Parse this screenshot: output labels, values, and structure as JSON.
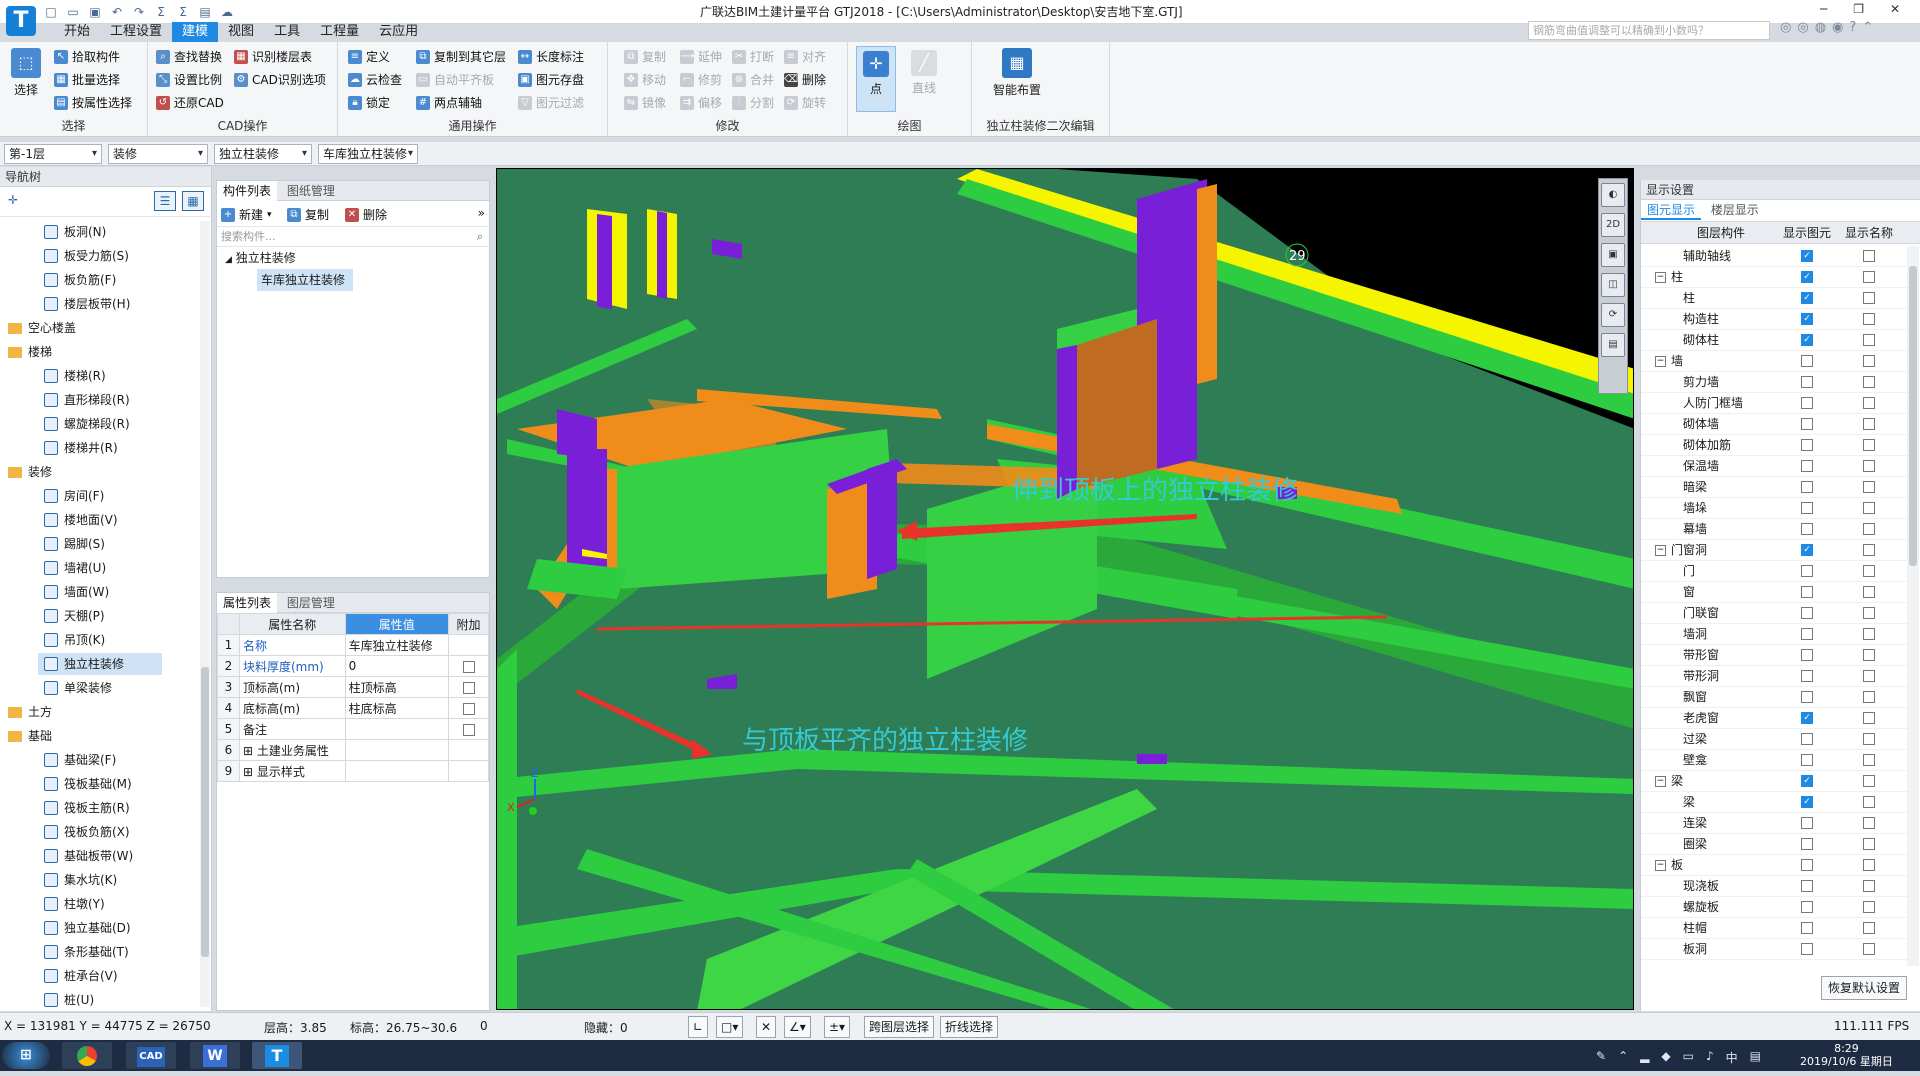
{
  "app": {
    "logo": "T",
    "title": "广联达BIM土建计量平台 GTJ2018 - [C:\\Users\\Administrator\\Desktop\\安吉地下室.GTJ]",
    "tabs": [
      "开始",
      "工程设置",
      "建模",
      "视图",
      "工具",
      "工程量",
      "云应用"
    ],
    "active_tab": "建模",
    "help_placeholder": "钢筋弯曲值调整可以精确到小数吗？",
    "accent": "#1e8ae3"
  },
  "ribbon": {
    "select": {
      "big": "选择",
      "items": [
        "拾取构件",
        "批量选择",
        "按属性选择"
      ],
      "title": "选择"
    },
    "cad": {
      "items": [
        "查找替换",
        "识别楼层表",
        "设置比例",
        "CAD识别选项",
        "还原CAD"
      ],
      "title": "CAD操作"
    },
    "common": {
      "items": [
        "定义",
        "复制到其它层",
        "长度标注",
        "云检查",
        "自动平齐板",
        "图元存盘",
        "锁定",
        "两点辅轴",
        "图元过滤"
      ],
      "title": "通用操作"
    },
    "modify": {
      "items": [
        "复制",
        "延伸",
        "打断",
        "对齐",
        "移动",
        "修剪",
        "合并",
        "删除",
        "镜像",
        "偏移",
        "分割",
        "旋转"
      ],
      "title": "修改"
    },
    "draw": {
      "items": [
        "点",
        "直线"
      ],
      "title": "绘图"
    },
    "smart": {
      "big": "智能布置",
      "title": "独立柱装修二次编辑"
    }
  },
  "filters": {
    "floor": "第-1层",
    "category": "装修",
    "type": "独立柱装修",
    "component": "车库独立柱装修"
  },
  "nav": {
    "title": "导航树",
    "items": [
      {
        "label": "板洞(N)",
        "indent": 2
      },
      {
        "label": "板受力筋(S)",
        "indent": 2
      },
      {
        "label": "板负筋(F)",
        "indent": 2
      },
      {
        "label": "楼层板带(H)",
        "indent": 2
      },
      {
        "label": "空心楼盖",
        "indent": 1,
        "folder": true
      },
      {
        "label": "楼梯",
        "indent": 1,
        "folder": true
      },
      {
        "label": "楼梯(R)",
        "indent": 2
      },
      {
        "label": "直形梯段(R)",
        "indent": 2
      },
      {
        "label": "螺旋梯段(R)",
        "indent": 2
      },
      {
        "label": "楼梯井(R)",
        "indent": 2
      },
      {
        "label": "装修",
        "indent": 1,
        "folder": true
      },
      {
        "label": "房间(F)",
        "indent": 2
      },
      {
        "label": "楼地面(V)",
        "indent": 2
      },
      {
        "label": "踢脚(S)",
        "indent": 2
      },
      {
        "label": "墙裙(U)",
        "indent": 2
      },
      {
        "label": "墙面(W)",
        "indent": 2
      },
      {
        "label": "天棚(P)",
        "indent": 2
      },
      {
        "label": "吊顶(K)",
        "indent": 2
      },
      {
        "label": "独立柱装修",
        "indent": 2,
        "selected": true
      },
      {
        "label": "单梁装修",
        "indent": 2
      },
      {
        "label": "土方",
        "indent": 1,
        "folder": true
      },
      {
        "label": "基础",
        "indent": 1,
        "folder": true
      },
      {
        "label": "基础梁(F)",
        "indent": 2
      },
      {
        "label": "筏板基础(M)",
        "indent": 2
      },
      {
        "label": "筏板主筋(R)",
        "indent": 2
      },
      {
        "label": "筏板负筋(X)",
        "indent": 2
      },
      {
        "label": "基础板带(W)",
        "indent": 2
      },
      {
        "label": "集水坑(K)",
        "indent": 2
      },
      {
        "label": "柱墩(Y)",
        "indent": 2
      },
      {
        "label": "独立基础(D)",
        "indent": 2
      },
      {
        "label": "条形基础(T)",
        "indent": 2
      },
      {
        "label": "桩承台(V)",
        "indent": 2
      },
      {
        "label": "桩(U)",
        "indent": 2
      }
    ]
  },
  "complist": {
    "tabs": [
      "构件列表",
      "图纸管理"
    ],
    "actions": [
      "新建",
      "复制",
      "删除"
    ],
    "search_placeholder": "搜索构件...",
    "tree": [
      "独立柱装修",
      "车库独立柱装修"
    ]
  },
  "props": {
    "tabs": [
      "属性列表",
      "图层管理"
    ],
    "headers": [
      "属性名称",
      "属性值",
      "附加"
    ],
    "rows": [
      {
        "n": "1",
        "name": "名称",
        "value": "车库独立柱装修",
        "check": false,
        "blue": true
      },
      {
        "n": "2",
        "name": "块料厚度(mm)",
        "value": "0",
        "check": true,
        "blue": true
      },
      {
        "n": "3",
        "name": "顶标高(m)",
        "value": "柱顶标高",
        "check": true,
        "blue": false
      },
      {
        "n": "4",
        "name": "底标高(m)",
        "value": "柱底标高",
        "check": true,
        "blue": false
      },
      {
        "n": "5",
        "name": "备注",
        "value": "",
        "check": true,
        "blue": false
      },
      {
        "n": "6",
        "name": "土建业务属性",
        "value": "",
        "check": false,
        "blue": false,
        "expand": true
      },
      {
        "n": "9",
        "name": "显示样式",
        "value": "",
        "check": false,
        "blue": false,
        "expand": true
      }
    ]
  },
  "viewport": {
    "annot1": "伸到顶板上的独立柱装修",
    "annot2": "与顶板平齐的独立柱装修",
    "axis_label": "29",
    "axis_x": "X",
    "axis_z": "Z"
  },
  "display": {
    "title": "显示设置",
    "tabs": [
      "图元显示",
      "楼层显示"
    ],
    "headers": [
      "图层构件",
      "显示图元",
      "显示名称"
    ],
    "restore": "恢复默认设置",
    "rows": [
      {
        "l": "辅助轴线",
        "s": true,
        "n": false
      },
      {
        "l": "柱",
        "g": true,
        "s": true,
        "n": false
      },
      {
        "l": "柱",
        "s": true,
        "n": false
      },
      {
        "l": "构造柱",
        "s": true,
        "n": false
      },
      {
        "l": "砌体柱",
        "s": true,
        "n": false
      },
      {
        "l": "墙",
        "g": true,
        "s": false,
        "n": false
      },
      {
        "l": "剪力墙",
        "s": false,
        "n": false
      },
      {
        "l": "人防门框墙",
        "s": false,
        "n": false
      },
      {
        "l": "砌体墙",
        "s": false,
        "n": false
      },
      {
        "l": "砌体加筋",
        "s": false,
        "n": false
      },
      {
        "l": "保温墙",
        "s": false,
        "n": false
      },
      {
        "l": "暗梁",
        "s": false,
        "n": false
      },
      {
        "l": "墙垛",
        "s": false,
        "n": false
      },
      {
        "l": "幕墙",
        "s": false,
        "n": false
      },
      {
        "l": "门窗洞",
        "g": true,
        "s": true,
        "n": false
      },
      {
        "l": "门",
        "s": false,
        "n": false
      },
      {
        "l": "窗",
        "s": false,
        "n": false
      },
      {
        "l": "门联窗",
        "s": false,
        "n": false
      },
      {
        "l": "墙洞",
        "s": false,
        "n": false
      },
      {
        "l": "带形窗",
        "s": false,
        "n": false
      },
      {
        "l": "带形洞",
        "s": false,
        "n": false
      },
      {
        "l": "飘窗",
        "s": false,
        "n": false
      },
      {
        "l": "老虎窗",
        "s": true,
        "n": false
      },
      {
        "l": "过梁",
        "s": false,
        "n": false
      },
      {
        "l": "壁龛",
        "s": false,
        "n": false
      },
      {
        "l": "梁",
        "g": true,
        "s": true,
        "n": false
      },
      {
        "l": "梁",
        "s": true,
        "n": false
      },
      {
        "l": "连梁",
        "s": false,
        "n": false
      },
      {
        "l": "圈梁",
        "s": false,
        "n": false
      },
      {
        "l": "板",
        "g": true,
        "s": false,
        "n": false
      },
      {
        "l": "现浇板",
        "s": false,
        "n": false
      },
      {
        "l": "螺旋板",
        "s": false,
        "n": false
      },
      {
        "l": "柱帽",
        "s": false,
        "n": false
      },
      {
        "l": "板洞",
        "s": false,
        "n": false
      }
    ]
  },
  "status": {
    "coords": "X = 131981 Y = 44775 Z = 26750",
    "floor_h": "层高：3.85",
    "elev": "标高：26.75~30.6",
    "zero": "0",
    "hidden": "隐藏：0",
    "btn1": "跨图层选择",
    "btn2": "折线选择",
    "fps": "111.111 FPS"
  },
  "taskbar": {
    "clock": "8:29",
    "date": "2019/10/6 星期日",
    "apps": [
      "chrome-icon",
      "cad-icon",
      "wps-icon",
      "gtj-icon"
    ]
  }
}
